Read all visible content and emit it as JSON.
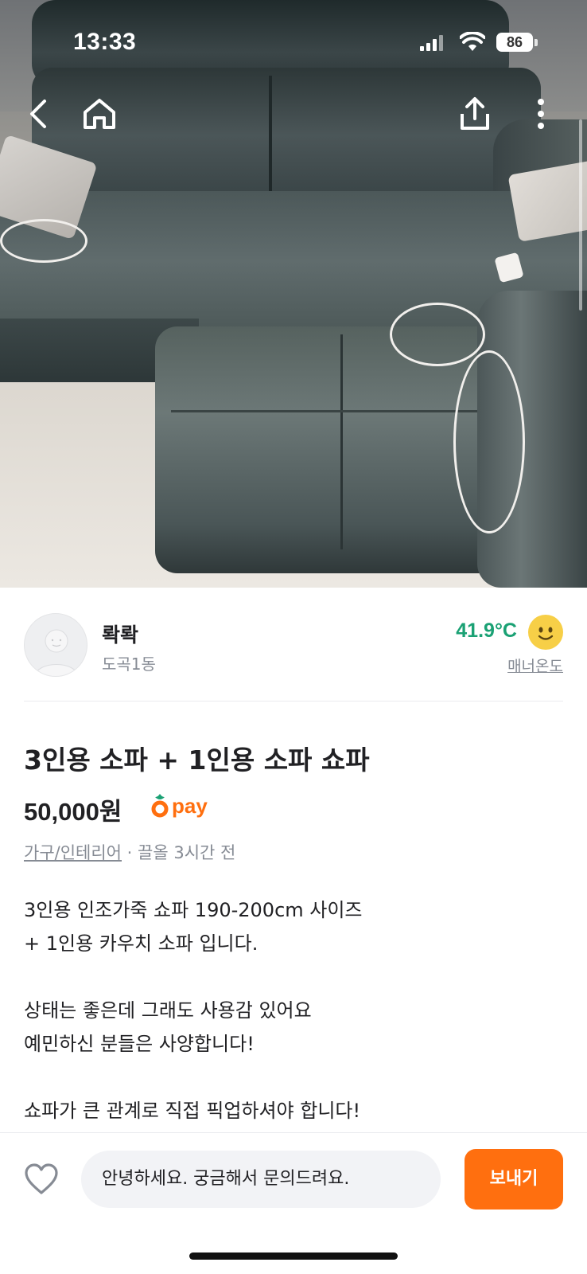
{
  "status_bar": {
    "time": "13:33",
    "battery": "86"
  },
  "nav": {
    "back_icon": "back-chevron-icon",
    "home_icon": "home-icon",
    "share_icon": "share-icon",
    "more_icon": "more-vertical-icon"
  },
  "seller": {
    "nickname": "롹롹",
    "region": "도곡1동",
    "temperature": "41.9°C",
    "manner_label": "매너온도"
  },
  "product": {
    "title": "3인용 소파 + 1인용 소파 쇼파",
    "price": "50,000원",
    "pay_label": "pay",
    "category": "가구/인테리어",
    "time_info": " · 끌올 3시간 전",
    "description": [
      "3인용 인조가죽 쇼파 190-200cm 사이즈",
      "+ 1인용 카우치 소파 입니다.",
      "",
      "상태는 좋은데 그래도 사용감 있어요",
      "예민하신 분들은 사양합니다!",
      "",
      "쇼파가 큰 관계로 직접 픽업하셔야 합니다!"
    ]
  },
  "bottom": {
    "chat_placeholder": "안녕하세요. 궁금해서 문의드려요.",
    "send_label": "보내기"
  },
  "colors": {
    "accent": "#ff6f0f",
    "temperature": "#1aa174",
    "muted": "#868b94"
  }
}
